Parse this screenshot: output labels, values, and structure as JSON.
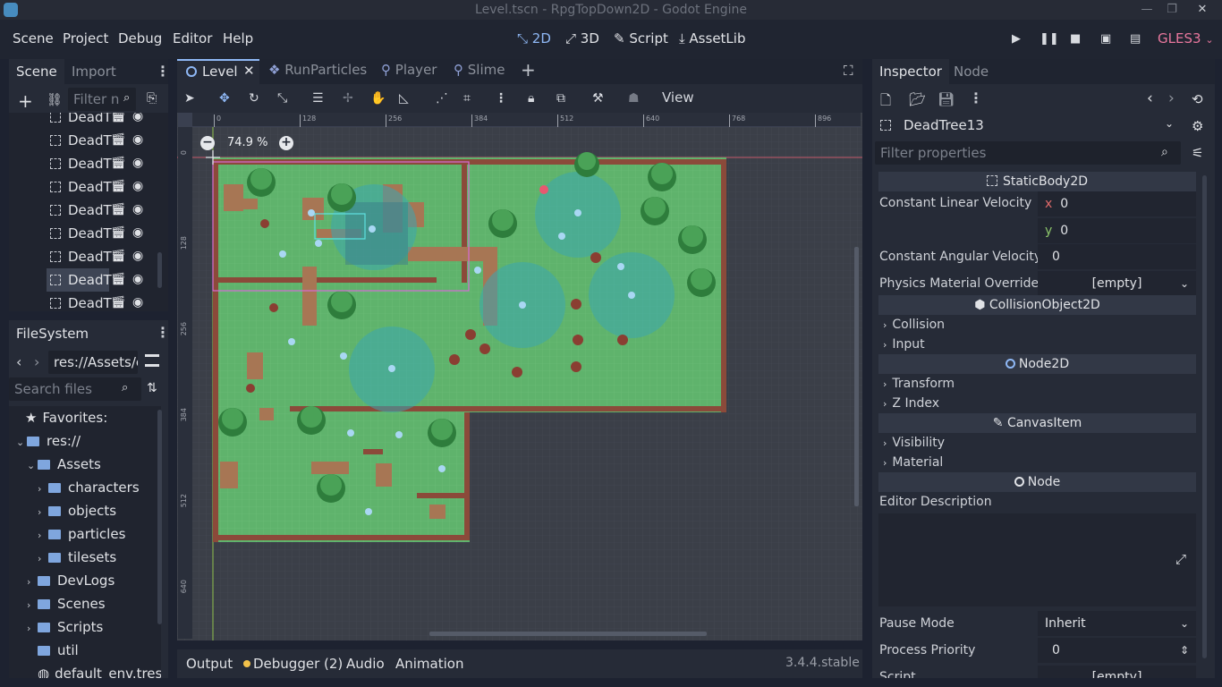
{
  "window": {
    "title": "Level.tscn - RpgTopDown2D - Godot Engine"
  },
  "menu": {
    "items": [
      "Scene",
      "Project",
      "Debug",
      "Editor",
      "Help"
    ]
  },
  "workspaces": {
    "2d": "2D",
    "3d": "3D",
    "script": "Script",
    "assetlib": "AssetLib"
  },
  "renderer": "GLES3",
  "scene_dock": {
    "tabs": [
      "Scene",
      "Import"
    ],
    "filter_placeholder": "Filter n",
    "nodes": [
      "DeadT",
      "DeadT",
      "DeadT",
      "DeadT",
      "DeadT",
      "DeadT",
      "DeadT",
      "DeadT",
      "DeadT"
    ],
    "selected_index": 7
  },
  "filesystem": {
    "title": "FileSystem",
    "path": "res://Assets/c",
    "search_placeholder": "Search files",
    "favorites": "Favorites:",
    "items": [
      {
        "label": "res://",
        "level": 0,
        "expanded": true,
        "folder": true
      },
      {
        "label": "Assets",
        "level": 1,
        "expanded": true,
        "folder": true
      },
      {
        "label": "characters",
        "level": 2,
        "expanded": false,
        "folder": true
      },
      {
        "label": "objects",
        "level": 2,
        "expanded": false,
        "folder": true
      },
      {
        "label": "particles",
        "level": 2,
        "expanded": false,
        "folder": true
      },
      {
        "label": "tilesets",
        "level": 2,
        "expanded": false,
        "folder": true
      },
      {
        "label": "DevLogs",
        "level": 1,
        "expanded": false,
        "folder": true
      },
      {
        "label": "Scenes",
        "level": 1,
        "expanded": false,
        "folder": true
      },
      {
        "label": "Scripts",
        "level": 1,
        "expanded": false,
        "folder": true
      },
      {
        "label": "util",
        "level": 1,
        "expanded": null,
        "folder": true
      },
      {
        "label": "default_env.tres",
        "level": 1,
        "expanded": null,
        "folder": false
      }
    ]
  },
  "editor_tabs": [
    "Level",
    "RunParticles",
    "Player",
    "Slime"
  ],
  "viewport": {
    "view_menu": "View",
    "zoom": "74.9 %",
    "ruler_h": [
      "0",
      "128",
      "256",
      "384",
      "512",
      "640",
      "768",
      "896"
    ],
    "ruler_v": [
      "0",
      "128",
      "256",
      "384",
      "512",
      "640"
    ]
  },
  "bottom_panel": {
    "tabs": [
      "Output",
      "Debugger (2)",
      "Audio",
      "Animation"
    ],
    "version": "3.4.4.stable"
  },
  "inspector": {
    "tabs": [
      "Inspector",
      "Node"
    ],
    "node_name": "DeadTree13",
    "filter_placeholder": "Filter properties",
    "sections": {
      "static_body": "StaticBody2D",
      "collision_object": "CollisionObject2D",
      "node2d": "Node2D",
      "canvas_item": "CanvasItem",
      "node": "Node"
    },
    "props": {
      "const_linear_velocity": "Constant Linear Velocity",
      "lin_x_axis": "x",
      "lin_x": "0",
      "lin_y_axis": "y",
      "lin_y": "0",
      "const_angular_velocity": "Constant Angular Velocity",
      "ang": "0",
      "physics_material": "Physics Material Override",
      "physics_material_value": "[empty]",
      "collision": "Collision",
      "input": "Input",
      "transform": "Transform",
      "z_index": "Z Index",
      "visibility": "Visibility",
      "material": "Material",
      "editor_description": "Editor Description",
      "pause_mode": "Pause Mode",
      "pause_mode_value": "Inherit",
      "process_priority": "Process Priority",
      "process_priority_value": "0",
      "script": "Script",
      "script_value": "[empty]"
    }
  },
  "colors": {
    "accent": "#8fb8f5",
    "gles": "#e8779d",
    "grass": "#5fb36c",
    "water": "#3aa6b0"
  }
}
